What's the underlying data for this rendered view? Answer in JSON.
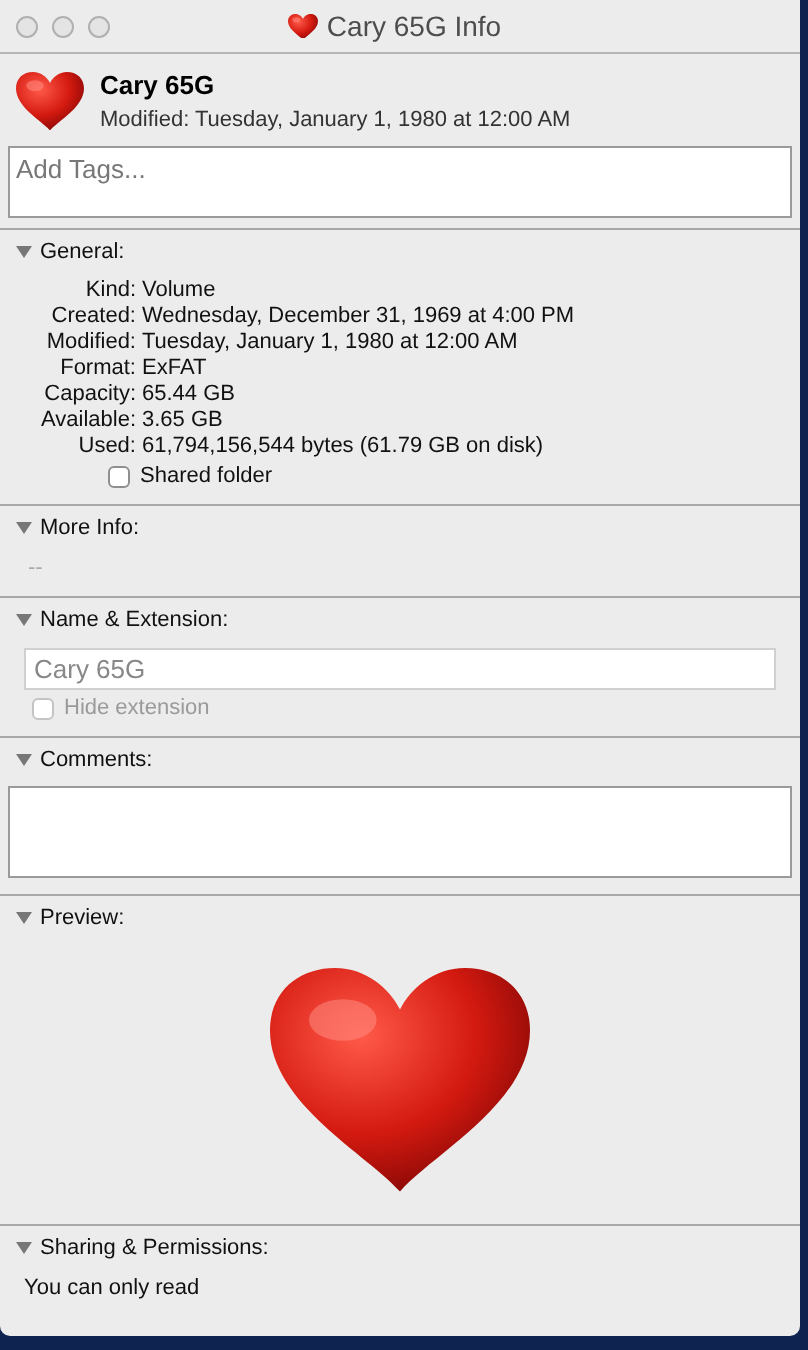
{
  "window": {
    "title": "Cary 65G Info",
    "active": false
  },
  "header": {
    "name": "Cary 65G",
    "modified": "Modified: Tuesday, January 1, 1980 at 12:00 AM"
  },
  "tags": {
    "placeholder": "Add Tags..."
  },
  "sections": [
    {
      "kind": "properties",
      "title": "General:",
      "expanded": true,
      "rows": [
        {
          "label": "Kind:",
          "value": "Volume"
        },
        {
          "label": "Created:",
          "value": "Wednesday, December 31, 1969 at 4:00 PM"
        },
        {
          "label": "Modified:",
          "value": "Tuesday, January 1, 1980 at 12:00 AM"
        },
        {
          "label": "Format:",
          "value": "ExFAT"
        },
        {
          "label": "Capacity:",
          "value": "65.44 GB"
        },
        {
          "label": "Available:",
          "value": "3.65 GB"
        },
        {
          "label": "Used:",
          "value": "61,794,156,544 bytes (61.79 GB on disk)"
        }
      ],
      "checkbox": {
        "label": "Shared folder",
        "checked": false,
        "disabled": false
      }
    },
    {
      "kind": "text",
      "title": "More Info:",
      "expanded": true,
      "text": "--",
      "muted": true
    },
    {
      "kind": "name",
      "title": "Name & Extension:",
      "expanded": true,
      "value": "Cary 65G",
      "disabled": true,
      "checkbox": {
        "label": "Hide extension",
        "checked": false,
        "disabled": true
      }
    },
    {
      "kind": "comments",
      "title": "Comments:",
      "expanded": true
    },
    {
      "kind": "preview",
      "title": "Preview:",
      "expanded": true
    },
    {
      "kind": "text",
      "title": "Sharing & Permissions:",
      "expanded": true,
      "text": "You can only read",
      "muted": false
    }
  ]
}
